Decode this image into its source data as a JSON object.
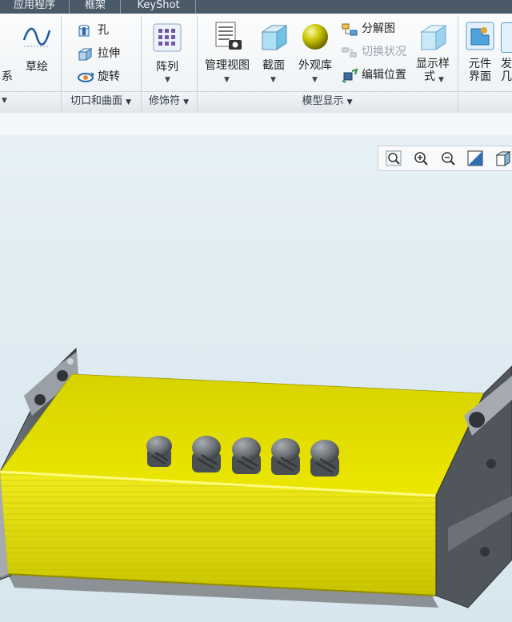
{
  "tabs": [
    {
      "label": "应用程序"
    },
    {
      "label": "框架"
    },
    {
      "label": "KeyShot"
    }
  ],
  "ribbon": {
    "left_partial": {
      "coordinate_label": "系",
      "sketch_label": "草绘"
    },
    "cut_group": {
      "hole": "孔",
      "extrude": "拉伸",
      "revolve": "旋转",
      "label": "切口和曲面"
    },
    "modifier_group": {
      "pattern": "阵列",
      "label": "修饰符"
    },
    "model_display_group": {
      "manage_views": "管理视图",
      "section": "截面",
      "appearance_library": "外观库",
      "exploded_view": "分解图",
      "toggle_state": "切换状况",
      "edit_position": "编辑位置",
      "display_style_line1": "显示样",
      "display_style_line2": "式",
      "label": "模型显示"
    },
    "right_partial": {
      "component_interface_line1": "元件",
      "component_interface_line2": "界面",
      "partial_line1": "发",
      "partial_line2": "几"
    }
  },
  "view_toolbar": {
    "icons": [
      "zoom-fit-icon",
      "zoom-in-icon",
      "zoom-out-icon",
      "view-orientation-icon",
      "cube-view-icon"
    ]
  },
  "colors": {
    "accent_yellow": "#e8e300",
    "dark_metal": "#555b61",
    "gland_gray": "#6f7479"
  }
}
